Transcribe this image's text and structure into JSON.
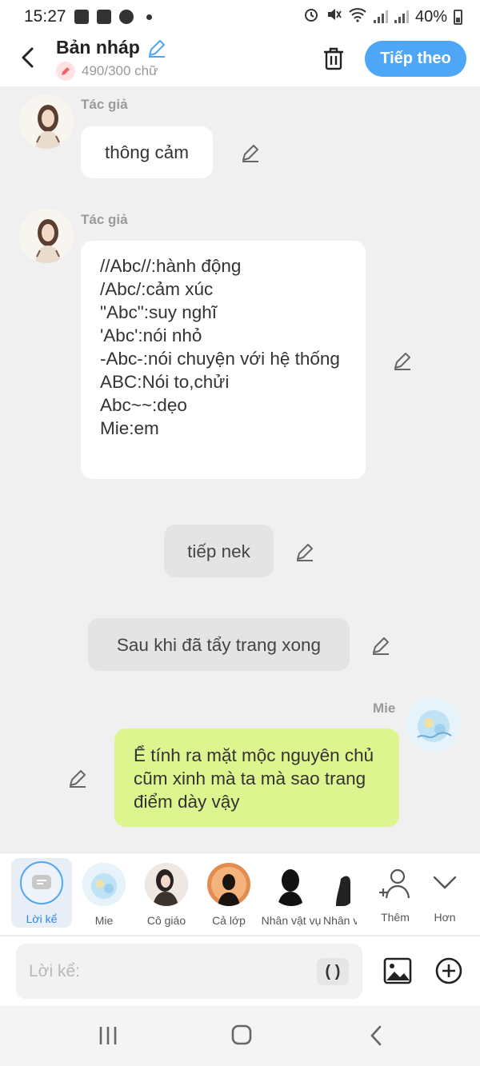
{
  "status_bar": {
    "time": "15:27",
    "battery": "40%"
  },
  "header": {
    "title": "Bản nháp",
    "char_count": "490/300 chữ",
    "next_label": "Tiếp theo"
  },
  "messages": [
    {
      "sender": "Tác giả",
      "text": "thông cảm"
    },
    {
      "sender": "Tác giả",
      "text": "//Abc//:hành động\n/Abc/:cảm xúc\n\"Abc\":suy nghĩ\n'Abc':nói nhỏ\n-Abc-:nói chuyện với hệ thống\nABC:Nói to,chửi\nAbc~~:dẹo\nMie:em"
    },
    {
      "text": "tiếp nek"
    },
    {
      "text": "Sau khi đã tẩy trang xong"
    },
    {
      "sender": "Mie",
      "text": "Ể tính ra mặt mộc nguyên chủ cũm xinh mà ta mà sao trang điểm dày vậy"
    }
  ],
  "characters": [
    {
      "label": "Lời kể"
    },
    {
      "label": "Mie"
    },
    {
      "label": "Cô giáo"
    },
    {
      "label": "Cả lớp"
    },
    {
      "label": "Nhân vật vụ"
    },
    {
      "label": "Nhân v"
    },
    {
      "label": "Thêm"
    },
    {
      "label": "Hơn"
    }
  ],
  "input": {
    "placeholder": "Lời kể:",
    "paren_label": "( )"
  },
  "colors": {
    "accent": "#4ea7f6",
    "bubble_green": "#ddf58e",
    "background": "#f0f0f0"
  }
}
